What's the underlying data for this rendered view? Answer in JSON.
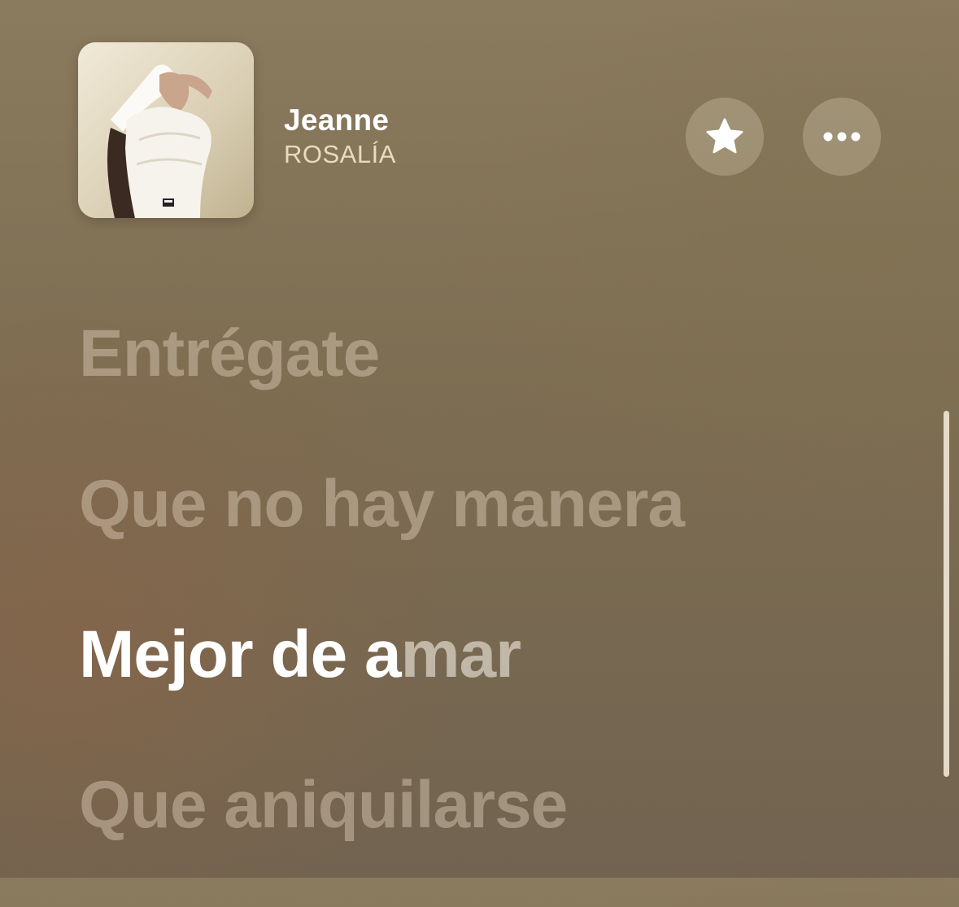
{
  "now_playing": {
    "title": "Jeanne",
    "artist": "ROSALÍA",
    "album_art_icon": "album-cover"
  },
  "actions": {
    "favorite_icon": "star-icon",
    "more_icon": "ellipsis-icon"
  },
  "lyrics": {
    "lines": [
      {
        "text": "Entrégate",
        "state": "past"
      },
      {
        "text": "Que no hay manera",
        "state": "past"
      },
      {
        "sung": "Mejor de a",
        "unsung": "mar",
        "state": "current"
      },
      {
        "text": "Que aniquilarse",
        "state": "upcoming"
      }
    ]
  }
}
